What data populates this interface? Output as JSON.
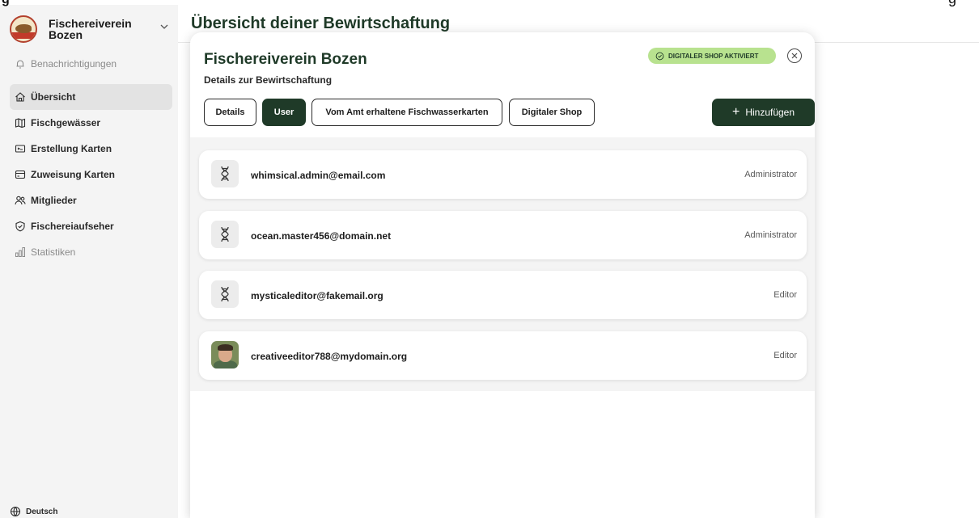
{
  "sidebar": {
    "org_name": "Fischereiverein Bozen",
    "notifications_label": "Benachrichtigungen",
    "items": [
      {
        "label": "Übersicht",
        "icon": "home-icon",
        "active": true
      },
      {
        "label": "Fischgewässer",
        "icon": "map-icon"
      },
      {
        "label": "Erstellung Karten",
        "icon": "ticket-icon"
      },
      {
        "label": "Zuweisung Karten",
        "icon": "card-icon"
      },
      {
        "label": "Mitglieder",
        "icon": "users-icon"
      },
      {
        "label": "Fischereiaufseher",
        "icon": "shield-icon"
      },
      {
        "label": "Statistiken",
        "icon": "chart-icon",
        "muted": true
      }
    ],
    "language_label": "Deutsch"
  },
  "header": {
    "title": "Übersicht deiner Bewirtschaftung"
  },
  "modal": {
    "title": "Fischereiverein Bozen",
    "subtitle": "Details zur Bewirtschaftung",
    "badge_label": "DIGITALER SHOP AKTIVIERT",
    "tabs": [
      {
        "label": "Details"
      },
      {
        "label": "User",
        "active": true
      },
      {
        "label": "Vom Amt erhaltene Fischwasserkarten"
      },
      {
        "label": "Digitaler Shop"
      }
    ],
    "add_button_label": "Hinzufügen",
    "users": [
      {
        "email": "whimsical.admin@email.com",
        "role": "Administrator",
        "avatar": "dna-icon"
      },
      {
        "email": "ocean.master456@domain.net",
        "role": "Administrator",
        "avatar": "dna-icon"
      },
      {
        "email": "mysticaleditor@fakemail.org",
        "role": "Editor",
        "avatar": "dna-icon"
      },
      {
        "email": "creativeeditor788@mydomain.org",
        "role": "Editor",
        "avatar": "photo"
      }
    ]
  },
  "colors": {
    "brand_dark_green": "#1f3a28",
    "badge_green": "#b8e28f",
    "sidebar_bg": "#f4f4f4"
  }
}
